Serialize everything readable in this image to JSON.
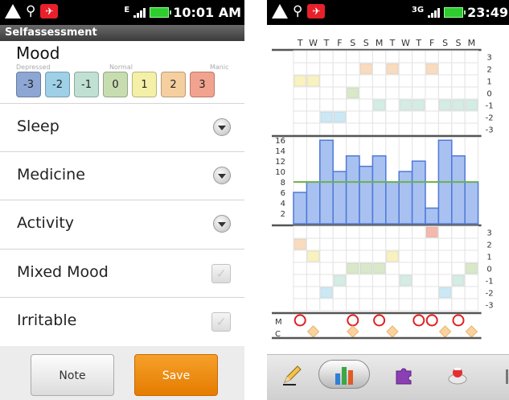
{
  "left_phone": {
    "status": {
      "network": "E",
      "time": "10:01 AM"
    },
    "app_title": "Selfassessment",
    "mood": {
      "title": "Mood",
      "scale_labels": [
        "Depressed",
        "Normal",
        "Manic"
      ],
      "buttons": [
        {
          "label": "-3",
          "color": "#8ea6d4"
        },
        {
          "label": "-2",
          "color": "#9ed0e8"
        },
        {
          "label": "-1",
          "color": "#bfe0d2"
        },
        {
          "label": "0",
          "color": "#c7ddb0"
        },
        {
          "label": "1",
          "color": "#f5f0a8"
        },
        {
          "label": "2",
          "color": "#f6cf9f"
        },
        {
          "label": "3",
          "color": "#f2a38f"
        }
      ]
    },
    "rows": {
      "sleep": "Sleep",
      "medicine": "Medicine",
      "activity": "Activity",
      "mixed_mood": "Mixed Mood",
      "irritable": "Irritable"
    },
    "buttons": {
      "note": "Note",
      "save": "Save"
    }
  },
  "right_phone": {
    "status": {
      "network": "3G",
      "time": "23:49"
    },
    "chart_data": {
      "type": "heatmap",
      "day_labels": [
        "T",
        "W",
        "T",
        "F",
        "S",
        "S",
        "M",
        "T",
        "W",
        "T",
        "F",
        "S",
        "S",
        "M"
      ],
      "mood_scale": [
        "3",
        "2",
        "1",
        "0",
        "-1",
        "-2",
        "-3"
      ],
      "upper_mood_cells": [
        {
          "day": 0,
          "level": 1
        },
        {
          "day": 1,
          "level": 1
        },
        {
          "day": 2,
          "level": -2
        },
        {
          "day": 3,
          "level": -2
        },
        {
          "day": 4,
          "level": 0
        },
        {
          "day": 5,
          "level": 2
        },
        {
          "day": 6,
          "level": -1
        },
        {
          "day": 7,
          "level": 2
        },
        {
          "day": 8,
          "level": -1
        },
        {
          "day": 9,
          "level": -1
        },
        {
          "day": 10,
          "level": 2
        },
        {
          "day": 11,
          "level": -1
        },
        {
          "day": 12,
          "level": -1
        },
        {
          "day": 13,
          "level": -1
        }
      ],
      "sleep_axis_ticks": [
        "16",
        "14",
        "12",
        "10",
        "8",
        "6",
        "4",
        "2"
      ],
      "sleep_hours": [
        6,
        8,
        16,
        10,
        13,
        11,
        13,
        8,
        10,
        12,
        3,
        16,
        13,
        8
      ],
      "sleep_target": 8,
      "lower_mood_cells": [
        {
          "day": 0,
          "level": 2
        },
        {
          "day": 1,
          "level": 1
        },
        {
          "day": 2,
          "level": -2
        },
        {
          "day": 3,
          "level": -1
        },
        {
          "day": 4,
          "level": 0
        },
        {
          "day": 5,
          "level": 0
        },
        {
          "day": 6,
          "level": 0
        },
        {
          "day": 7,
          "level": 1
        },
        {
          "day": 8,
          "level": -1
        },
        {
          "day": 10,
          "level": 3
        },
        {
          "day": 11,
          "level": -2
        },
        {
          "day": 12,
          "level": -1
        },
        {
          "day": 13,
          "level": 0
        }
      ],
      "row_labels": [
        "M",
        "C"
      ],
      "medicine_days": [
        0,
        4,
        6,
        9,
        10,
        12
      ],
      "c_days": [
        1,
        4,
        7,
        11,
        13
      ],
      "colors": {
        "plus3": "#f4b9ad",
        "plus2": "#f9dcbf",
        "plus1": "#f8f2c0",
        "zero": "#d8e8c8",
        "minus1": "#d4ece4",
        "minus2": "#cbe8f4",
        "minus3": "#c4d2ec",
        "bar_fill": "#a9c1f0",
        "bar_stroke": "#4d79d8",
        "target_line": "#6bb04a",
        "medicine": "#e02020",
        "c_marker": "#f9d2a0"
      }
    }
  }
}
